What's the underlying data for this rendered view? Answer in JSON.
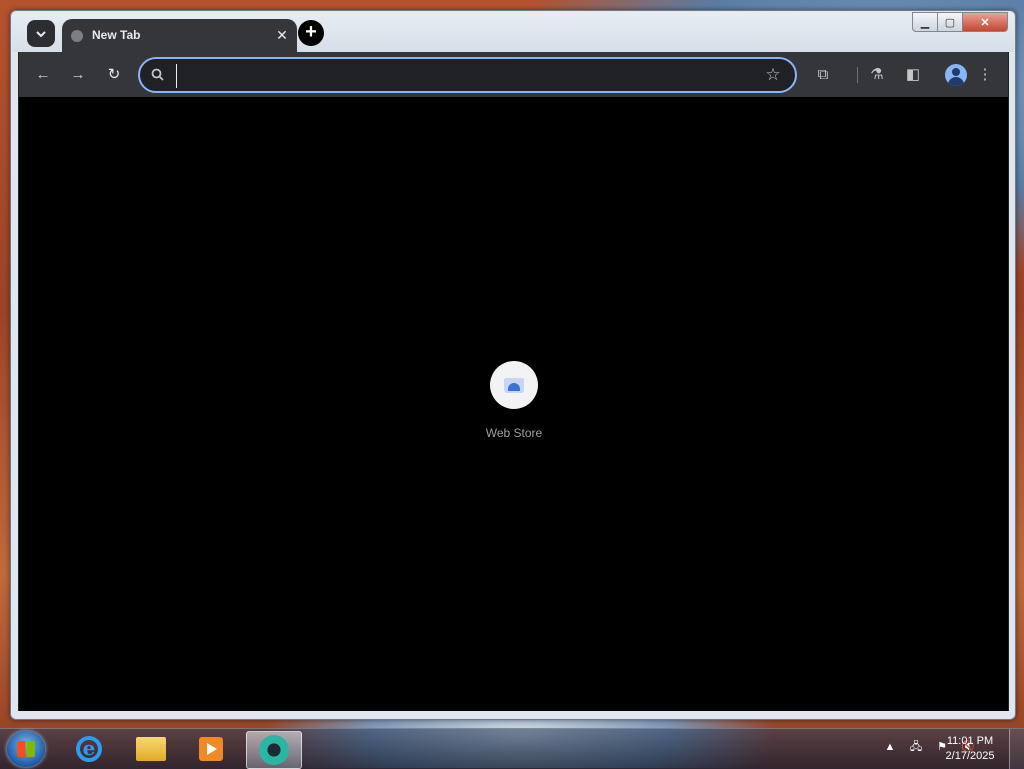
{
  "browser": {
    "tab_search_icon": "chevron-down-icon",
    "tabs": [
      {
        "title": "New Tab",
        "favicon": "globe-icon",
        "close_glyph": "✕"
      }
    ],
    "new_tab_glyph": "+",
    "window_controls": {
      "minimize": "▁",
      "maximize": "▢",
      "close": "✕"
    },
    "toolbar": {
      "back_glyph": "←",
      "forward_glyph": "→",
      "reload_glyph": "↻",
      "address_value": "",
      "address_placeholder": "",
      "bookmark_glyph": "☆",
      "extensions_glyph": "⧉",
      "labs_glyph": "⚗",
      "side_panel_glyph": "◧",
      "menu_glyph": "⋮"
    },
    "new_tab_page": {
      "shortcuts": [
        {
          "label": "Web Store",
          "icon": "web-store-icon"
        }
      ]
    },
    "colors": {
      "accent": "#8ab4f8",
      "toolbar_bg": "#35363a",
      "content_bg": "#000000"
    }
  },
  "taskbar": {
    "apps": [
      {
        "name": "Internet Explorer",
        "icon": "internet-explorer-icon",
        "active": false
      },
      {
        "name": "Windows Explorer",
        "icon": "folder-icon",
        "active": false
      },
      {
        "name": "Windows Media Player",
        "icon": "media-player-icon",
        "active": false
      },
      {
        "name": "Chromium",
        "icon": "chromium-icon",
        "active": true
      }
    ],
    "tray": {
      "show_hidden_glyph": "▲",
      "network_glyph": "🖧",
      "flag_glyph": "⚑",
      "volume_glyph": "🔇"
    },
    "clock": {
      "time": "11:01 PM",
      "date": "2/17/2025"
    }
  }
}
